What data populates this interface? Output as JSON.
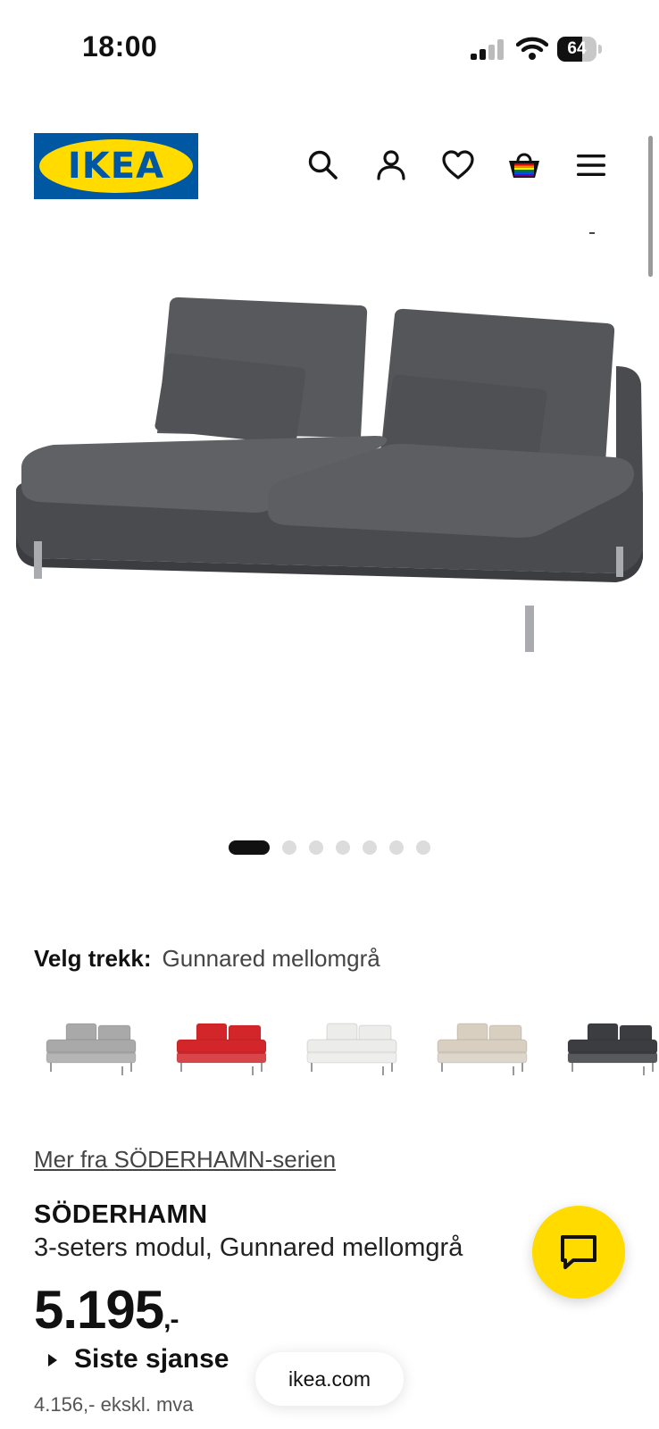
{
  "status_bar": {
    "time": "18:00",
    "battery": "64",
    "battery_level": 0.64
  },
  "header": {
    "logo_text": "IKEA",
    "icons": [
      "search-icon",
      "account-icon",
      "heart-icon",
      "basket-icon",
      "menu-icon"
    ]
  },
  "colors": {
    "brand_blue": "#0058a3",
    "brand_yellow": "#ffdb00",
    "sofa_selected": "#55565a"
  },
  "carousel": {
    "total": 7,
    "active_index": 1
  },
  "color_picker": {
    "label": "Velg trekk:",
    "selected": "Gunnared mellomgrå",
    "swatch_colors": [
      "#a9a9a9",
      "#d3262a",
      "#ececea",
      "#d8cfc1",
      "#3c3d41"
    ]
  },
  "product": {
    "series_link": "Mer fra SÖDERHAMN-serien",
    "name": "SÖDERHAMN",
    "description": "3-seters modul, Gunnared mellomgrå",
    "price": "5.195",
    "price_suffix": ",-",
    "last_chance": "Siste sjanse",
    "price_ex_vat": "4.156,- ekskl. mva"
  },
  "browser": {
    "url": "ikea.com"
  }
}
